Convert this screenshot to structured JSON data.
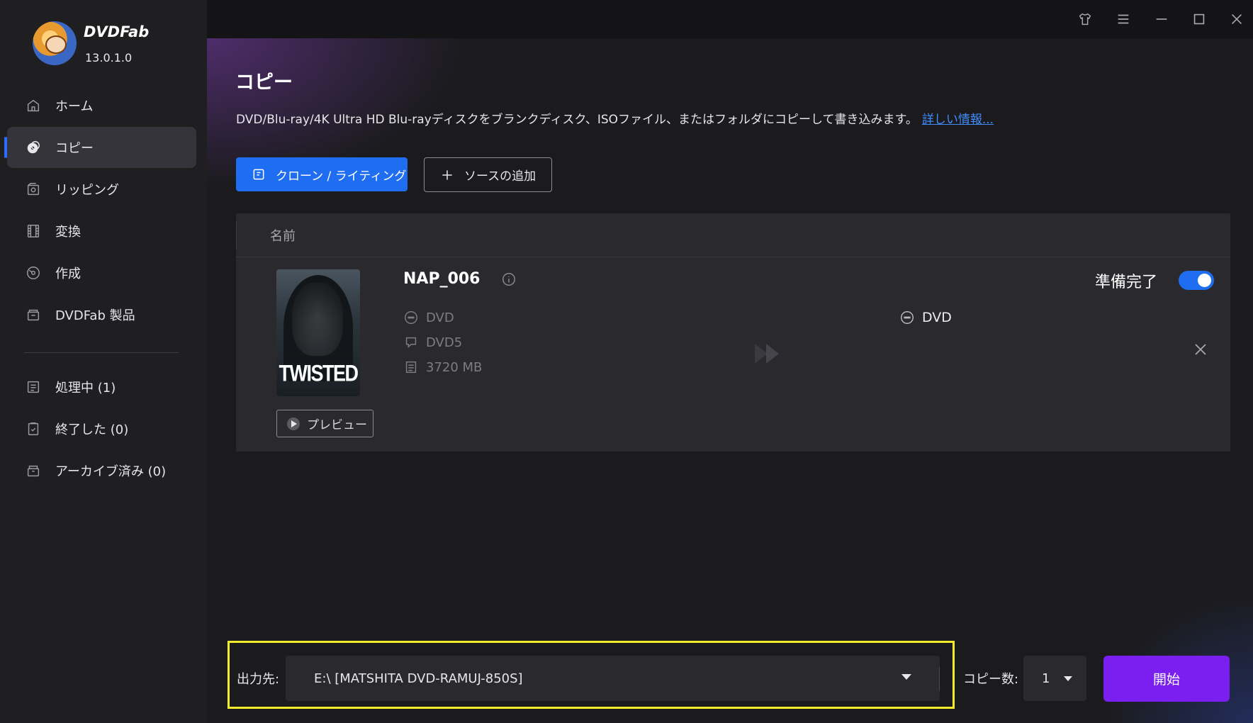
{
  "app": {
    "brand": "DVDFab",
    "version": "13.0.1.0"
  },
  "sidebar": {
    "items": [
      {
        "label": "ホーム",
        "icon": "home-icon"
      },
      {
        "label": "コピー",
        "icon": "copy-disc-icon",
        "active": true
      },
      {
        "label": "リッピング",
        "icon": "ripping-icon"
      },
      {
        "label": "変換",
        "icon": "film-icon"
      },
      {
        "label": "作成",
        "icon": "create-disc-icon"
      },
      {
        "label": "DVDFab 製品",
        "icon": "box-icon"
      }
    ],
    "tasks": [
      {
        "label": "処理中 (1)",
        "icon": "processing-list-icon"
      },
      {
        "label": "終了した (0)",
        "icon": "clipboard-check-icon"
      },
      {
        "label": "アーカイブ済み (0)",
        "icon": "archive-icon"
      }
    ]
  },
  "titlebar": {
    "icons": [
      "shirt-icon",
      "menu-icon",
      "minimize-icon",
      "maximize-icon",
      "close-icon"
    ]
  },
  "main": {
    "title": "コピー",
    "description": "DVD/Blu-ray/4K Ultra HD Blu-rayディスクをブランクディスク、ISOファイル、またはフォルダにコピーして書き込みます。",
    "more_link": "詳しい情報...",
    "clone_button": "クローン / ライティング",
    "add_source_button": "ソースの追加",
    "table": {
      "column_name": "名前",
      "item": {
        "title": "NAP_006",
        "poster_title": "TWISTED",
        "source_type": "DVD",
        "disc_format": "DVD5",
        "size": "3720 MB",
        "preview_label": "プレビュー",
        "target_type": "DVD",
        "status": "準備完了",
        "enabled": true
      }
    }
  },
  "footer": {
    "output_label": "出力先:",
    "output_value": "E:\\ [MATSHITA DVD-RAMUJ-850S]",
    "copies_label": "コピー数:",
    "copies_value": "1",
    "start_button": "開始"
  },
  "colors": {
    "accent": "#1f6df0",
    "start": "#7a1ff0",
    "highlight": "#f2ec2a",
    "link": "#3f8cff"
  }
}
